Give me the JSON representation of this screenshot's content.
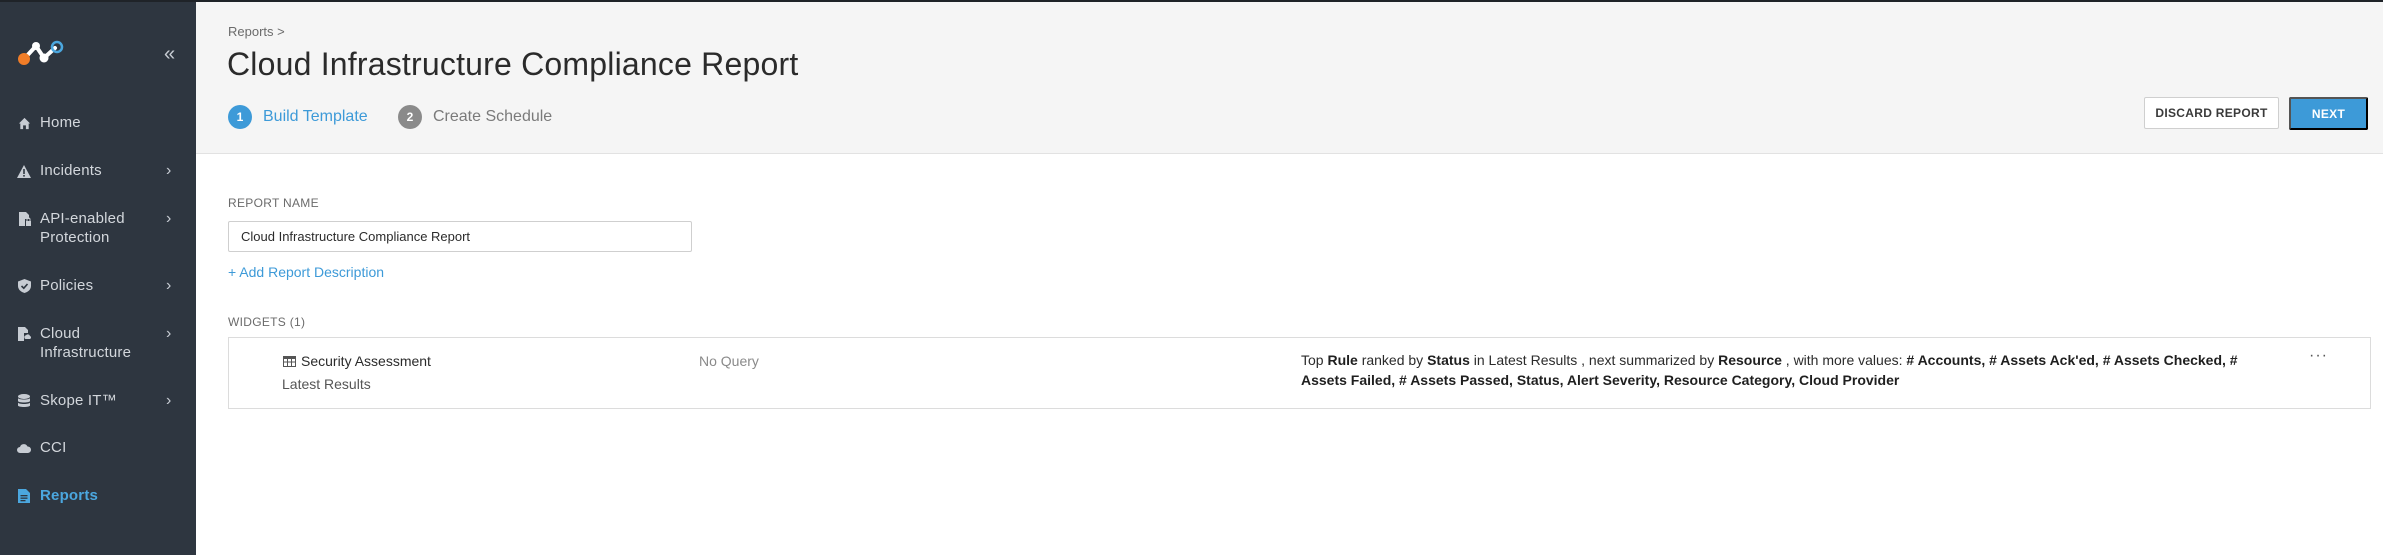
{
  "sidebar": {
    "items": [
      {
        "label": "Home",
        "icon": "home-icon"
      },
      {
        "label": "Incidents",
        "icon": "warning-icon"
      },
      {
        "label": "API-enabled Protection",
        "icon": "document-lock-icon"
      },
      {
        "label": "Policies",
        "icon": "shield-icon"
      },
      {
        "label": "Cloud Infrastructure",
        "icon": "cloud-infra-icon"
      },
      {
        "label": "Skope IT™",
        "icon": "database-icon"
      },
      {
        "label": "CCI",
        "icon": "cloud-icon"
      },
      {
        "label": "Reports",
        "icon": "report-icon"
      }
    ],
    "active": "Reports"
  },
  "header": {
    "breadcrumb": "Reports >",
    "title": "Cloud Infrastructure Compliance Report",
    "steps": [
      {
        "number": "1",
        "label": "Build Template"
      },
      {
        "number": "2",
        "label": "Create Schedule"
      }
    ],
    "discard_label": "DISCARD REPORT",
    "next_label": "NEXT"
  },
  "form": {
    "report_name_label": "REPORT NAME",
    "report_name_value": "Cloud Infrastructure Compliance Report",
    "add_description_label": "+ Add Report Description",
    "widgets_label": "WIDGETS (1)"
  },
  "widgets": [
    {
      "title": "Security Assessment",
      "subtitle": "Latest Results",
      "query": "No Query",
      "summary": {
        "t1": "Top ",
        "b1": "Rule",
        "t2": " ranked by ",
        "b2": "Status",
        "t3": " in Latest Results , next summarized by ",
        "b3": "Resource",
        "t4": " , with more values: ",
        "b4": "# Accounts, # Assets Ack'ed, # Assets Checked, # Assets Failed, # Assets Passed, Status, Alert Severity, Resource Category, Cloud Provider"
      },
      "more": "···"
    }
  ],
  "colors": {
    "sidebar_bg": "#2e3640",
    "accent": "#3d9ad8",
    "header_bg": "#f5f5f5"
  }
}
